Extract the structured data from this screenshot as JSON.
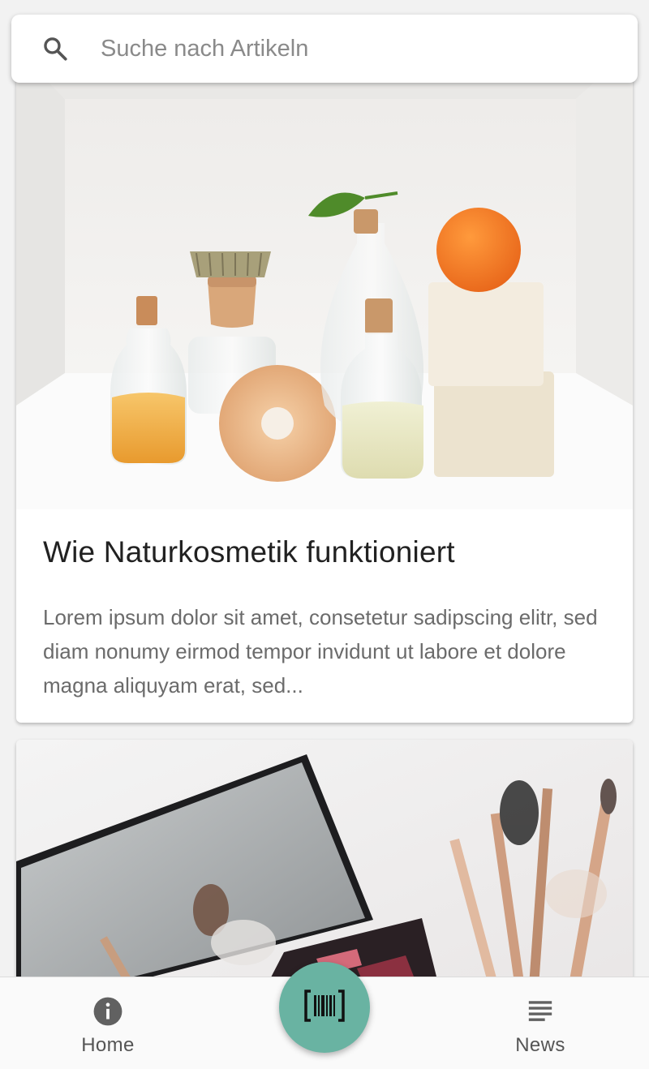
{
  "search": {
    "placeholder": "Suche nach Artikeln",
    "icon": "search-icon"
  },
  "articles": [
    {
      "title": "Wie Naturkosmetik funktioniert",
      "excerpt": "Lorem ipsum dolor sit amet, consetetur sadipscing elitr, sed diam nonumy eirmod tempor invidunt ut labore et dolore magna aliquyam erat, sed..."
    },
    {
      "title": "",
      "excerpt": ""
    }
  ],
  "bottom_nav": {
    "home_label": "Home",
    "home_icon": "info-icon",
    "scan_icon": "barcode-icon",
    "news_label": "News",
    "news_icon": "news-icon"
  },
  "colors": {
    "accent": "#69b3a2",
    "background": "#f2f2f2",
    "card": "#ffffff",
    "title_text": "#212121",
    "body_text": "#6b6b6b",
    "nav_icon": "#616161"
  }
}
